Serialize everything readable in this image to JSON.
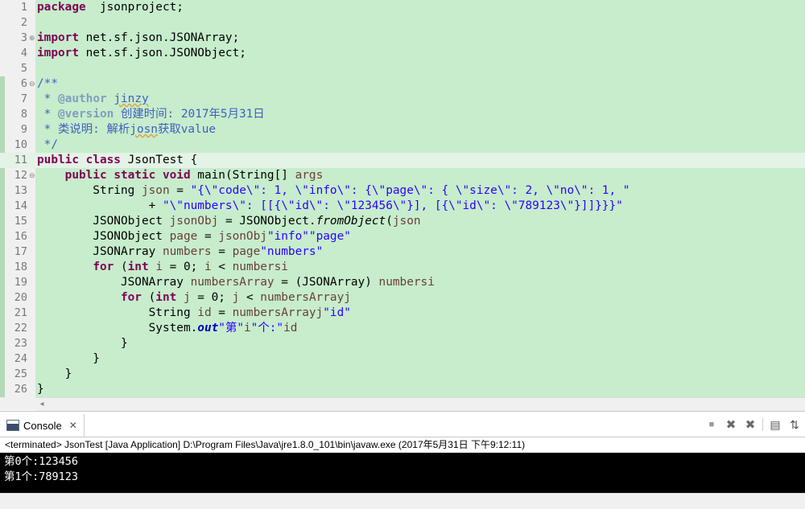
{
  "editor": {
    "lines": [
      {
        "n": "1",
        "segs": [
          [
            "kw",
            "package"
          ],
          [
            "",
            "  jsonproject;"
          ]
        ]
      },
      {
        "n": "2",
        "segs": []
      },
      {
        "n": "3",
        "fold": "⊕",
        "segs": [
          [
            "kw",
            "import"
          ],
          [
            "",
            " net.sf.json.JSONArray;"
          ]
        ]
      },
      {
        "n": "4",
        "segs": [
          [
            "kw",
            "import"
          ],
          [
            "",
            " net.sf.json.JSONObject;"
          ]
        ]
      },
      {
        "n": "5",
        "segs": []
      },
      {
        "n": "6",
        "fold": "⊖",
        "segs": [
          [
            "jd",
            "/**"
          ]
        ]
      },
      {
        "n": "7",
        "segs": [
          [
            "jd",
            " * "
          ],
          [
            "tag",
            "@author"
          ],
          [
            "jd",
            " "
          ],
          [
            "jdw",
            "jinzy"
          ]
        ]
      },
      {
        "n": "8",
        "segs": [
          [
            "jd",
            " * "
          ],
          [
            "tag",
            "@version"
          ],
          [
            "jd",
            " 创建时间: 2017年5月31日"
          ]
        ]
      },
      {
        "n": "9",
        "segs": [
          [
            "jd",
            " * 类说明: 解析"
          ],
          [
            "jdw",
            "josn"
          ],
          [
            "jd",
            "获取value"
          ]
        ]
      },
      {
        "n": "10",
        "segs": [
          [
            "jd",
            " */"
          ]
        ]
      },
      {
        "n": "11",
        "cur": true,
        "segs": [
          [
            "kw",
            "public"
          ],
          [
            "",
            " "
          ],
          [
            "kw",
            "class"
          ],
          [
            "",
            " JsonTest {"
          ]
        ]
      },
      {
        "n": "12",
        "fold": "⊖",
        "segs": [
          [
            "",
            "    "
          ],
          [
            "kw",
            "public"
          ],
          [
            "",
            " "
          ],
          [
            "kw",
            "static"
          ],
          [
            "",
            " "
          ],
          [
            "kw",
            "void"
          ],
          [
            "",
            " main(String[] "
          ],
          [
            "var",
            "args"
          ],
          [
            ") {"
          ]
        ]
      },
      {
        "n": "13",
        "segs": [
          [
            "",
            "        String "
          ],
          [
            "var",
            "json"
          ],
          [
            "",
            " = "
          ],
          [
            "str",
            "\"{\\\"code\\\": 1, \\\"info\\\": {\\\"page\\\": { \\\"size\\\": 2, \\\"no\\\": 1, \""
          ]
        ]
      },
      {
        "n": "14",
        "segs": [
          [
            "",
            "                + "
          ],
          [
            "str",
            "\"\\\"numbers\\\": [[{\\\"id\\\": \\\"123456\\\"}], [{\\\"id\\\": \\\"789123\\\"}]]}}}\""
          ],
          [
            ";"
          ]
        ]
      },
      {
        "n": "15",
        "segs": [
          [
            "",
            "        JSONObject "
          ],
          [
            "var",
            "jsonObj"
          ],
          [
            "",
            " = JSONObject."
          ],
          [
            "it",
            "fromObject"
          ],
          [
            "",
            "("
          ],
          [
            "var",
            "json"
          ],
          [
            ");"
          ]
        ]
      },
      {
        "n": "16",
        "segs": [
          [
            "",
            "        JSONObject "
          ],
          [
            "var",
            "page"
          ],
          [
            "",
            " = "
          ],
          [
            "var",
            "jsonObj"
          ],
          [
            ".getJSONObject("
          ],
          [
            "str",
            "\"info\""
          ],
          [
            ").getJSONObject("
          ],
          [
            "str",
            "\"page\""
          ],
          [
            ");"
          ]
        ]
      },
      {
        "n": "17",
        "segs": [
          [
            "",
            "        JSONArray "
          ],
          [
            "var",
            "numbers"
          ],
          [
            "",
            " = "
          ],
          [
            "var",
            "page"
          ],
          [
            ".getJSONArray("
          ],
          [
            "str",
            "\"numbers\""
          ],
          [
            ");"
          ]
        ]
      },
      {
        "n": "18",
        "segs": [
          [
            "",
            "        "
          ],
          [
            "kw",
            "for"
          ],
          [
            "",
            " ("
          ],
          [
            "kw",
            "int"
          ],
          [
            "",
            " "
          ],
          [
            "var",
            "i"
          ],
          [
            "",
            " = 0; "
          ],
          [
            "var",
            "i"
          ],
          [
            "",
            " < "
          ],
          [
            "var",
            "numbers"
          ],
          [
            ".size(); "
          ],
          [
            "var",
            "i"
          ],
          [
            "++) {"
          ]
        ]
      },
      {
        "n": "19",
        "segs": [
          [
            "",
            "            JSONArray "
          ],
          [
            "var",
            "numbersArray"
          ],
          [
            "",
            " = (JSONArray) "
          ],
          [
            "var",
            "numbers"
          ],
          [
            ".get("
          ],
          [
            "var",
            "i"
          ],
          [
            ");"
          ]
        ]
      },
      {
        "n": "20",
        "segs": [
          [
            "",
            "            "
          ],
          [
            "kw",
            "for"
          ],
          [
            "",
            " ("
          ],
          [
            "kw",
            "int"
          ],
          [
            "",
            " "
          ],
          [
            "var",
            "j"
          ],
          [
            "",
            " = 0; "
          ],
          [
            "var",
            "j"
          ],
          [
            "",
            " < "
          ],
          [
            "var",
            "numbersArray"
          ],
          [
            ".size(); "
          ],
          [
            "var",
            "j"
          ],
          [
            "++) {"
          ]
        ]
      },
      {
        "n": "21",
        "segs": [
          [
            "",
            "                String "
          ],
          [
            "var",
            "id"
          ],
          [
            "",
            " = "
          ],
          [
            "var",
            "numbersArray"
          ],
          [
            ".getJSONObject("
          ],
          [
            "var",
            "j"
          ],
          [
            ").getString("
          ],
          [
            "str",
            "\"id\""
          ],
          [
            ");"
          ]
        ]
      },
      {
        "n": "22",
        "segs": [
          [
            "",
            "                System."
          ],
          [
            "fld",
            "out"
          ],
          [
            ".println("
          ],
          [
            "str",
            "\"第\""
          ],
          [
            " + "
          ],
          [
            "var",
            "i"
          ],
          [
            " + "
          ],
          [
            "str",
            "\"个:\""
          ],
          [
            " + "
          ],
          [
            "var",
            "id"
          ],
          [
            ");"
          ]
        ]
      },
      {
        "n": "23",
        "segs": [
          [
            "",
            "            }"
          ]
        ]
      },
      {
        "n": "24",
        "segs": [
          [
            "",
            "        }"
          ]
        ]
      },
      {
        "n": "25",
        "segs": [
          [
            "",
            "    }"
          ]
        ]
      },
      {
        "n": "26",
        "segs": [
          [
            "",
            "}"
          ]
        ]
      }
    ]
  },
  "console": {
    "tab_label": "Console",
    "terminated": "<terminated> JsonTest [Java Application] D:\\Program Files\\Java\\jre1.8.0_101\\bin\\javaw.exe (2017年5月31日 下午9:12:11)",
    "output": [
      "第0个:123456",
      "第1个:789123"
    ]
  },
  "icons": {
    "console_close": "✕",
    "terminate": "■",
    "remove_launch": "✖",
    "remove_all": "✖",
    "scroll_lock": "▤",
    "pin": "⇅"
  }
}
